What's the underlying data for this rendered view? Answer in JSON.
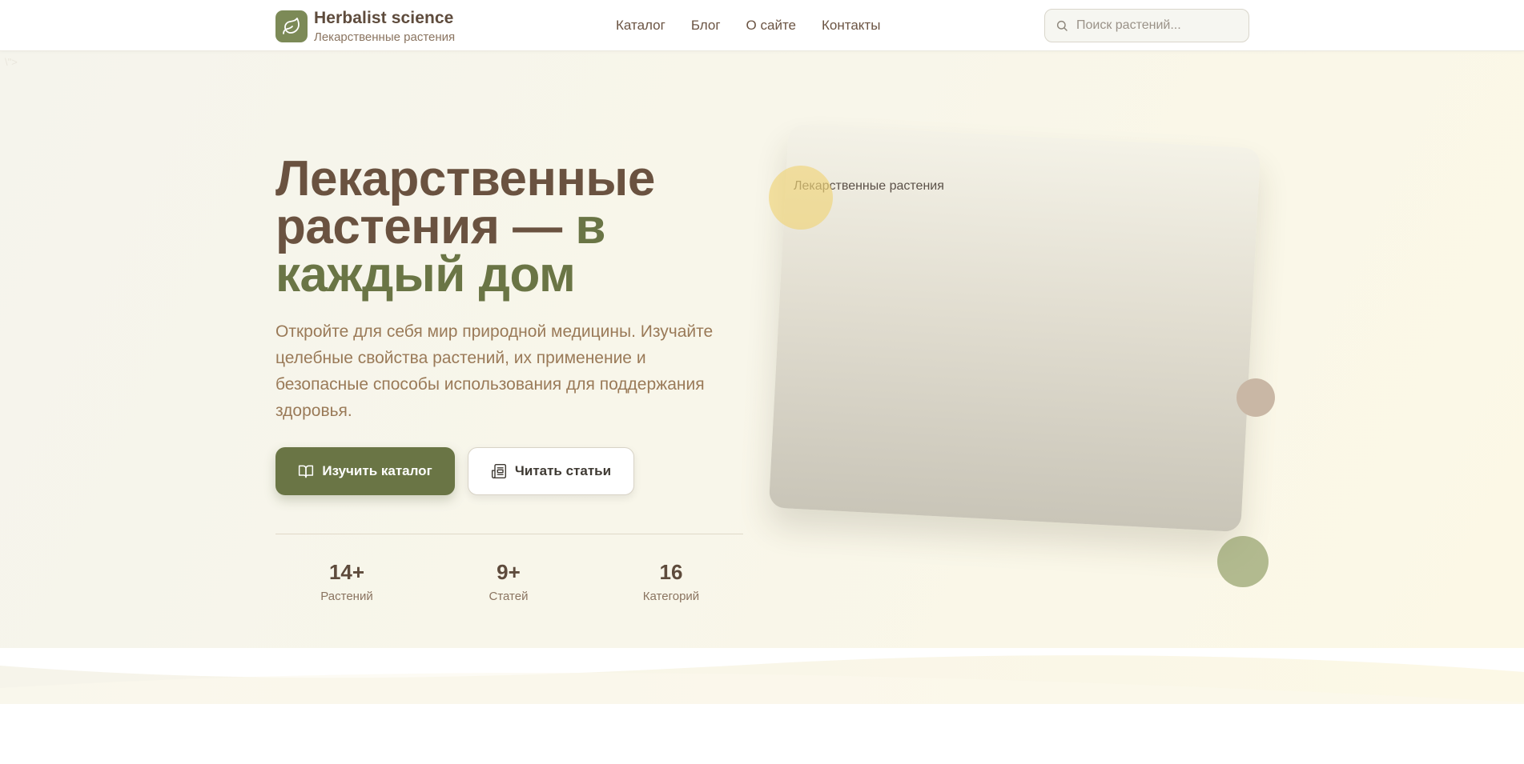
{
  "header": {
    "logo_title": "Herbalist science",
    "logo_subtitle": "Лекарственные растения",
    "nav": [
      {
        "label": "Каталог"
      },
      {
        "label": "Блог"
      },
      {
        "label": "О сайте"
      },
      {
        "label": "Контакты"
      }
    ],
    "search": {
      "placeholder": "Поиск растений...",
      "icon": "search-icon"
    }
  },
  "hero": {
    "tag_text": "\\\">",
    "title_part1": "Лекарственные растения — ",
    "title_accent": "в каждый дом",
    "description": "Откройте для себя мир природной медицины. Изучайте целебные свойства растений, их применение и безопасные способы использования для поддержания здоровья.",
    "primary_button": {
      "label": "Изучить каталог",
      "icon": "book-icon"
    },
    "secondary_button": {
      "label": "Читать статьи",
      "icon": "newspaper-icon"
    },
    "stats": [
      {
        "value": "14+",
        "label": "Растений"
      },
      {
        "value": "9+",
        "label": "Статей"
      },
      {
        "value": "16",
        "label": "Категорий"
      }
    ],
    "card_caption": "Лекарственные растения"
  },
  "colors": {
    "brand": "#6a7545",
    "heading": "#6a5240",
    "text": "#9a7a58"
  }
}
